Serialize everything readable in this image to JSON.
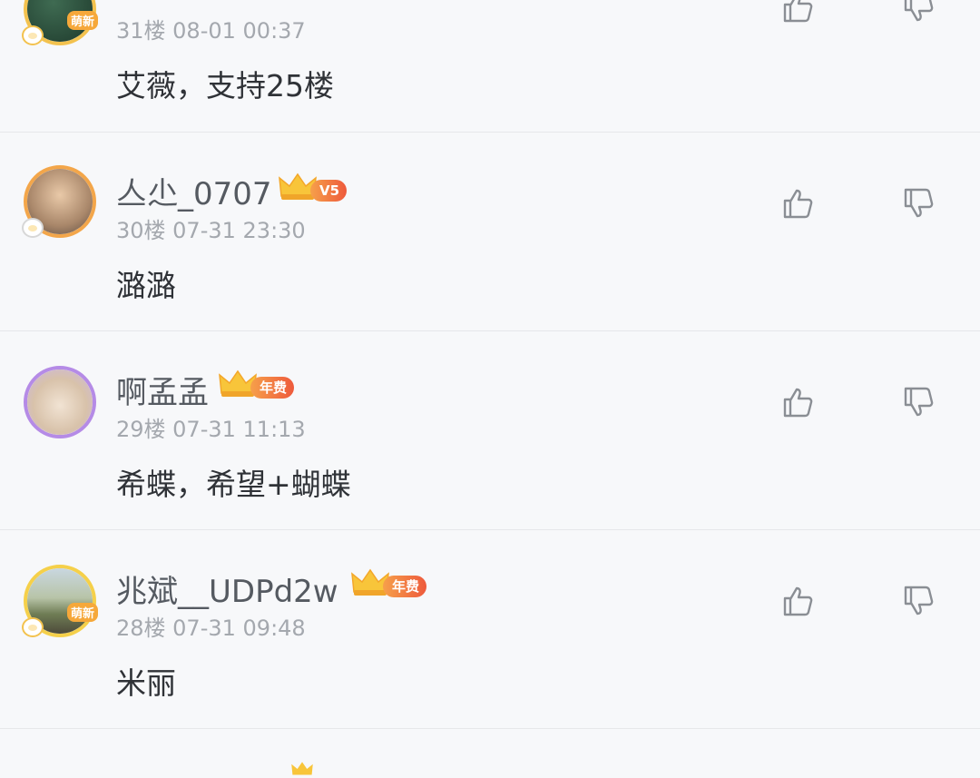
{
  "comments": [
    {
      "username": "",
      "vip_level": "",
      "floor_time": "31楼 08-01 00:37",
      "avatar_tag": "萌新",
      "content": "艾薇，支持25楼"
    },
    {
      "username": "亼尐_0707",
      "vip_level": "V5",
      "floor_time": "30楼 07-31 23:30",
      "avatar_tag": "",
      "content": "潞潞"
    },
    {
      "username": "啊孟孟",
      "vip_level": "年费",
      "floor_time": "29楼 07-31 11:13",
      "avatar_tag": "",
      "content": "希蝶，希望+蝴蝶"
    },
    {
      "username": "兆斌__UDPd2w",
      "vip_level": "年费",
      "floor_time": "28楼 07-31 09:48",
      "avatar_tag": "萌新",
      "content": "米丽"
    }
  ],
  "icons": {
    "like": "thumbs-up-icon",
    "dislike": "thumbs-down-icon",
    "crown": "crown-icon"
  },
  "colors": {
    "background": "#f7f8fa",
    "username": "#555a61",
    "meta": "#a4a8ae",
    "content": "#2f3237",
    "vip_gradient_start": "#f6a04a",
    "vip_gradient_end": "#ee5a3c",
    "crown": "#f8c53a"
  }
}
